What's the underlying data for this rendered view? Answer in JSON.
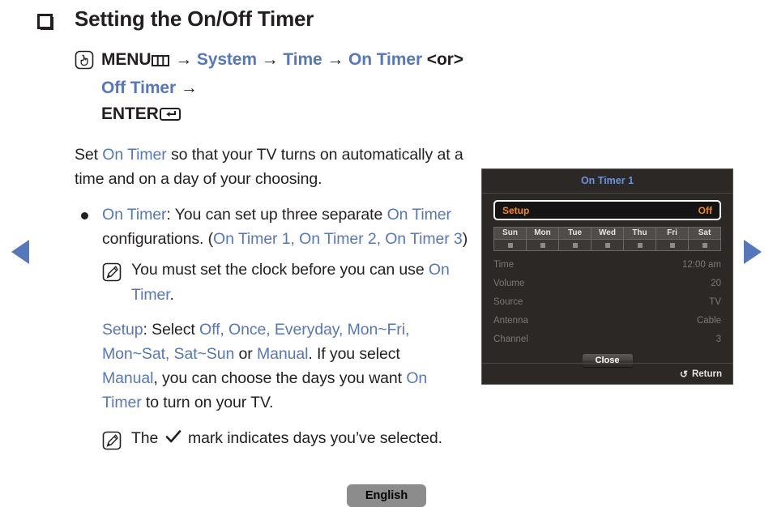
{
  "page": {
    "heading": "Setting the On/Off Timer",
    "language_label": "English"
  },
  "nav": {
    "prev_label": "previous page",
    "next_label": "next page"
  },
  "menu_path": {
    "press_icon": "press-button-icon",
    "menu_word": "MENU",
    "menu_icon": "menu-grid-icon",
    "arrow": "→",
    "step_system": "System",
    "step_time": "Time",
    "step_on_timer": "On Timer",
    "or_text": "<or>",
    "step_off_timer": "Off Timer",
    "enter_word": "ENTER",
    "enter_icon": "enter-return-icon"
  },
  "intro": {
    "part1": "Set ",
    "link1": "On Timer",
    "part2": " so that your TV turns on automatically at a time and on a day of your choosing."
  },
  "bullet": {
    "dot_icon": "bullet-dot",
    "link1": "On Timer",
    "part1": ": You can set up three separate ",
    "link2": "On Timer",
    "part2": " configurations. (",
    "link3": "On Timer 1",
    "sep1": ", ",
    "link4": "On Timer 2",
    "sep2": ", ",
    "link5": "On Timer 3",
    "part3": ")"
  },
  "note1": {
    "icon": "note-pencil-icon",
    "part1": "You must set the clock before you can use ",
    "link1": "On Timer",
    "part2": "."
  },
  "setup": {
    "link_setup": "Setup",
    "part1": ": Select ",
    "opt_off": "Off",
    "sep1": ", ",
    "opt_once": "Once",
    "sep2": ", ",
    "opt_everyday": "Everyday",
    "sep3": ", ",
    "opt_monfri": "Mon~Fri",
    "sep4": ", ",
    "opt_monsat": "Mon~Sat",
    "sep5": ", ",
    "opt_satsun": "Sat~Sun",
    "part2": " or ",
    "opt_manual": "Manual",
    "part3": ". If you select ",
    "link_manual2": "Manual",
    "part4": ", you can choose the days you want ",
    "link_ontimer": "On Timer",
    "part5": " to turn on your TV."
  },
  "note2": {
    "icon": "note-pencil-icon",
    "part1": "The ",
    "check": "check-mark-icon",
    "part2": " mark indicates days you’ve selected."
  },
  "osd": {
    "title": "On Timer 1",
    "setup_label": "Setup",
    "setup_value": "Off",
    "days": [
      "Sun",
      "Mon",
      "Tue",
      "Wed",
      "Thu",
      "Fri",
      "Sat"
    ],
    "rows": [
      {
        "label": "Time",
        "value": "12:00 am"
      },
      {
        "label": "Volume",
        "value": "20"
      },
      {
        "label": "Source",
        "value": "TV"
      },
      {
        "label": "Antenna",
        "value": "Cable"
      },
      {
        "label": "Channel",
        "value": "3"
      }
    ],
    "close_label": "Close",
    "return_label": "Return",
    "return_icon": "↺",
    "colors": {
      "accent_orange": "#f08b1d",
      "title_blue": "#6e93d6",
      "panel_bg": "#2b2826"
    }
  },
  "colors": {
    "link_blue": "#5577bb",
    "text": "#231f20"
  }
}
